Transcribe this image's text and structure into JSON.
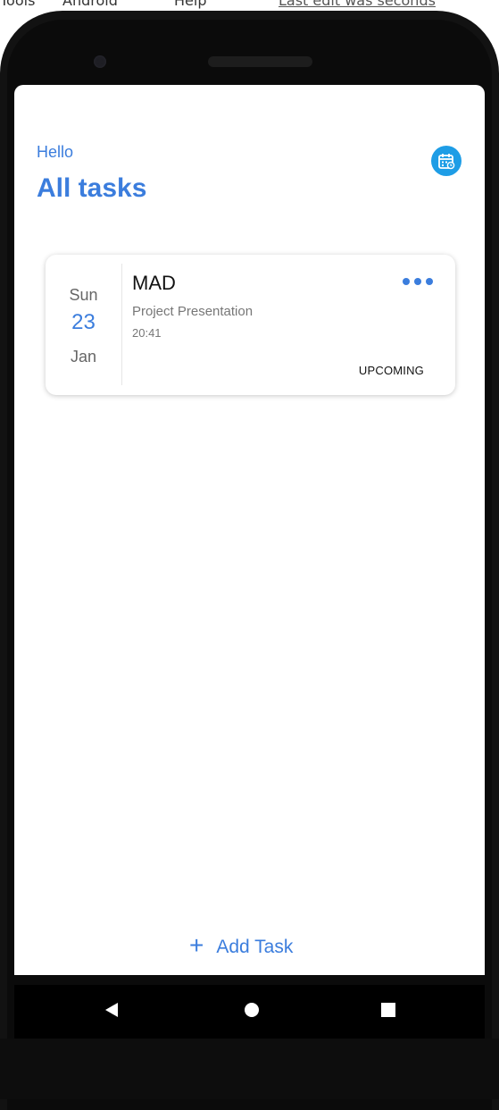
{
  "menubar": {
    "items": [
      "Tools",
      "Android",
      "Help"
    ],
    "status": "Last edit was seconds"
  },
  "header": {
    "greeting": "Hello",
    "title": "All tasks"
  },
  "tasks": [
    {
      "day": "Sun",
      "date": "23",
      "month": "Jan",
      "title": "MAD",
      "description": "Project Presentation",
      "time": "20:41",
      "status": "UPCOMING"
    }
  ],
  "footer": {
    "add_plus": "+",
    "add_label": "Add Task"
  },
  "icons": {
    "calendar": "calendar-icon",
    "more": "more-horizontal-icon",
    "back": "back-icon",
    "home": "home-icon",
    "recents": "recents-icon"
  },
  "colors": {
    "accent": "#3b7ddd",
    "calendar_button": "#1e9de6",
    "bezel": "#121212",
    "navbar": "#000000"
  }
}
